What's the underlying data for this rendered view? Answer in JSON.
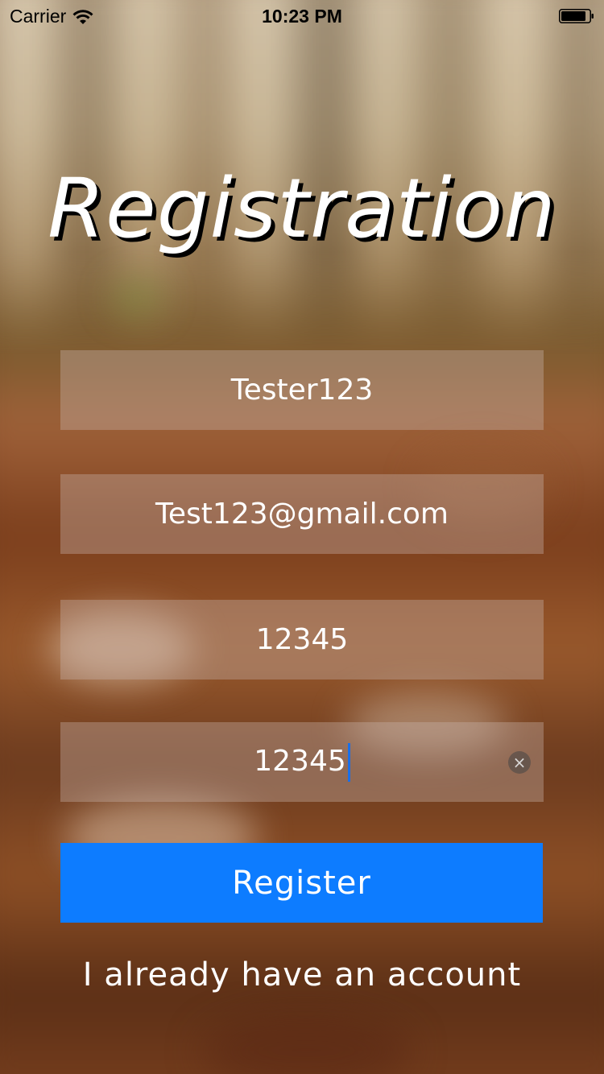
{
  "status_bar": {
    "carrier": "Carrier",
    "time": "10:23 PM",
    "wifi_icon": "wifi-icon",
    "battery_icon": "battery-icon"
  },
  "title": "Registration",
  "form": {
    "username": "Tester123",
    "email": "Test123@gmail.com",
    "password": "12345",
    "confirm_password": "12345",
    "clear_icon": "clear-icon"
  },
  "register_button_label": "Register",
  "login_link_label": "I already have an account",
  "colors": {
    "register_button": "#0d7cff",
    "caret": "#1a6fe8",
    "title_shadow": "#000000"
  }
}
